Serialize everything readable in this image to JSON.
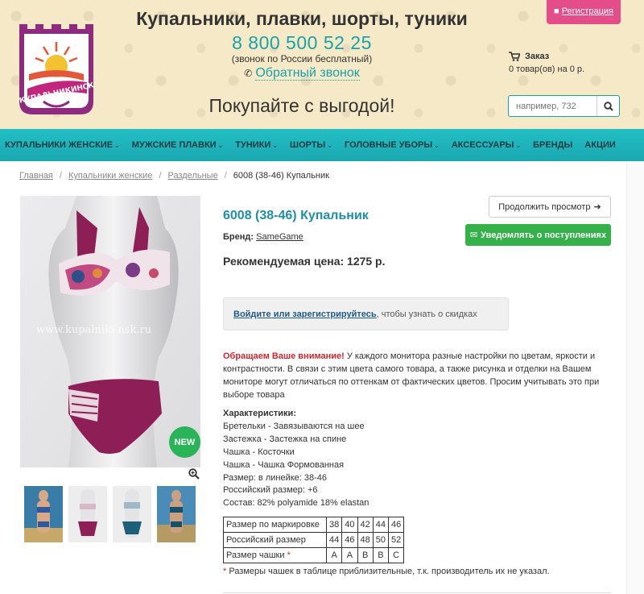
{
  "header": {
    "title": "Купальники, плавки, шорты, туники",
    "phone": "8 800 500 52 25",
    "phone_note": "(звонок по России бесплатный)",
    "callback": "Обратный звонок",
    "slogan": "Покупайте с выгодой!",
    "register": "Регистрация",
    "cart_title": "Заказ",
    "cart_status": "0 товар(ов) на 0 р.",
    "search_placeholder": "например, 732",
    "logo_text": "КУПАЛЬНИКИНСК"
  },
  "nav": {
    "items": [
      {
        "label": "КУПАЛЬНИКИ ЖЕНСКИЕ",
        "dropdown": true
      },
      {
        "label": "МУЖСКИЕ ПЛАВКИ",
        "dropdown": true
      },
      {
        "label": "ТУНИКИ",
        "dropdown": true
      },
      {
        "label": "ШОРТЫ",
        "dropdown": true
      },
      {
        "label": "ГОЛОВНЫЕ УБОРЫ",
        "dropdown": true
      },
      {
        "label": "АКСЕССУАРЫ",
        "dropdown": true
      },
      {
        "label": "БРЕНДЫ",
        "dropdown": false
      },
      {
        "label": "АКЦИИ",
        "dropdown": false
      }
    ]
  },
  "breadcrumb": {
    "items": [
      "Главная",
      "Купальники женские",
      "Раздельные"
    ],
    "current": "6008 (38-46) Купальник"
  },
  "product": {
    "title": "6008 (38-46) Купальник",
    "brand_label": "Бренд:",
    "brand": "SameGame",
    "price": "Рекомендуемая цена: 1275 р.",
    "badge": "NEW",
    "watermark": "www.kupalniki-nsk.ru",
    "continue_btn": "Продолжить просмотр",
    "notify_btn": "Уведомлять о поступлениях",
    "login_link": "Войдите или зарегистрируйтесь",
    "login_text": ", чтобы узнать о скидках",
    "notice_attn": "Обращаем Ваше внимание!",
    "notice_text": " У каждого монитора разные настройки по цветам, яркости и контрастности. В связи с этим цвета самого товара, а также рисунка и отделки на Вашем мониторе могут отличаться по оттенкам от фактических цветов. Просим учитывать это при выборе товара",
    "specs_title": "Характеристики:",
    "specs": [
      "Бретельки - Завязываются на шее",
      "Застежка - Застежка на спине",
      "Чашка - Косточки",
      "Чашка - Чашка Формованная",
      "Размер: в линейке: 38-46",
      "Российский размер: +6",
      "Состав: 82% polyamide 18% elastan"
    ]
  },
  "size_table": {
    "rows": [
      {
        "label": "Размер по маркировке",
        "values": [
          "38",
          "40",
          "42",
          "44",
          "46"
        ]
      },
      {
        "label": "Российский размер",
        "values": [
          "44",
          "46",
          "48",
          "50",
          "52"
        ]
      },
      {
        "label": "Размер чашки",
        "values": [
          "A",
          "A",
          "B",
          "B",
          "C"
        ]
      }
    ],
    "asterisk": "*",
    "footnote": "Размеры чашек в таблице приблизительные, т.к. производитель их не указал."
  },
  "colors": {
    "accent": "#18a2aa",
    "nav": "#1fb5bd",
    "title": "#1f8fa8",
    "register": "#e44c8a",
    "notify": "#35b149",
    "new_badge": "#2ab45a",
    "swimsuit": "#8e1f56"
  }
}
